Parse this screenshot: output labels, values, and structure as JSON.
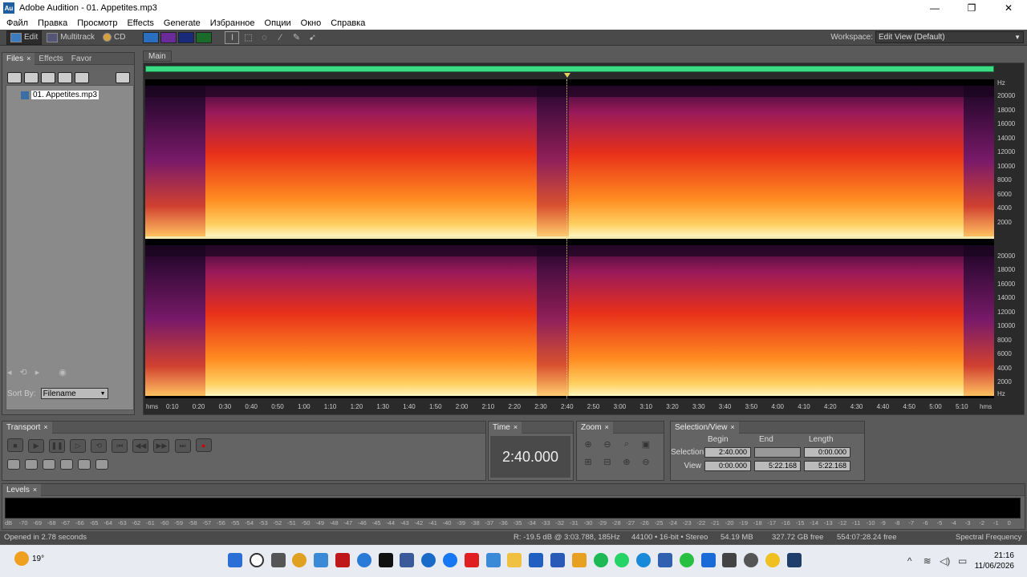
{
  "window": {
    "title": "Adobe Audition - 01. Appetites.mp3",
    "app_icon": "Au"
  },
  "menu": [
    "Файл",
    "Правка",
    "Просмотр",
    "Effects",
    "Generate",
    "Избранное",
    "Опции",
    "Окно",
    "Справка"
  ],
  "toolbar": {
    "edit": "Edit",
    "multitrack": "Multitrack",
    "cd": "CD",
    "workspace_label": "Workspace:",
    "workspace_value": "Edit View (Default)"
  },
  "files_panel": {
    "tabs": [
      "Files",
      "Effects",
      "Favor"
    ],
    "file": "01. Appetites.mp3",
    "sort_label": "Sort By:",
    "sort_value": "Filename"
  },
  "main_panel": {
    "tab": "Main",
    "hz_labels": [
      "Hz",
      "20000",
      "18000",
      "16000",
      "14000",
      "12000",
      "10000",
      "8000",
      "6000",
      "4000",
      "2000",
      "Hz"
    ],
    "time_labels": [
      "hms",
      "0:10",
      "0:20",
      "0:30",
      "0:40",
      "0:50",
      "1:00",
      "1:10",
      "1:20",
      "1:30",
      "1:40",
      "1:50",
      "2:00",
      "2:10",
      "2:20",
      "2:30",
      "2:40",
      "2:50",
      "3:00",
      "3:10",
      "3:20",
      "3:30",
      "3:40",
      "3:50",
      "4:00",
      "4:10",
      "4:20",
      "4:30",
      "4:40",
      "4:50",
      "5:00",
      "5:10",
      "hms"
    ]
  },
  "transport": {
    "tab": "Transport"
  },
  "time": {
    "tab": "Time",
    "value": "2:40.000"
  },
  "zoom": {
    "tab": "Zoom"
  },
  "selection": {
    "tab": "Selection/View",
    "begin_hdr": "Begin",
    "end_hdr": "End",
    "length_hdr": "Length",
    "sel_label": "Selection",
    "view_label": "View",
    "sel_begin": "2:40.000",
    "sel_end": "",
    "sel_length": "0:00.000",
    "view_begin": "0:00.000",
    "view_end": "5:22.168",
    "view_length": "5:22.168"
  },
  "levels": {
    "tab": "Levels",
    "scale": [
      "dB",
      "-70",
      "-69",
      "-68",
      "-67",
      "-66",
      "-65",
      "-64",
      "-63",
      "-62",
      "-61",
      "-60",
      "-59",
      "-58",
      "-57",
      "-56",
      "-55",
      "-54",
      "-53",
      "-52",
      "-51",
      "-50",
      "-49",
      "-48",
      "-47",
      "-46",
      "-45",
      "-44",
      "-43",
      "-42",
      "-41",
      "-40",
      "-39",
      "-38",
      "-37",
      "-36",
      "-35",
      "-34",
      "-33",
      "-32",
      "-31",
      "-30",
      "-29",
      "-28",
      "-27",
      "-26",
      "-25",
      "-24",
      "-23",
      "-22",
      "-21",
      "-20",
      "-19",
      "-18",
      "-17",
      "-16",
      "-15",
      "-14",
      "-13",
      "-12",
      "-11",
      "-10",
      "-9",
      "-8",
      "-7",
      "-6",
      "-5",
      "-4",
      "-3",
      "-2",
      "-1",
      "0"
    ]
  },
  "status": {
    "opened": "Opened in 2.78 seconds",
    "cursor": "R: -19.5 dB @  3:03.788, 185Hz",
    "format": "44100 • 16-bit • Stereo",
    "size": "54.19 MB",
    "free": "327.72 GB free",
    "time_free": "554:07:28.24 free",
    "mode": "Spectral Frequency"
  },
  "taskbar": {
    "temp": "19°",
    "time": "21:16",
    "date": "11/06/2026"
  }
}
